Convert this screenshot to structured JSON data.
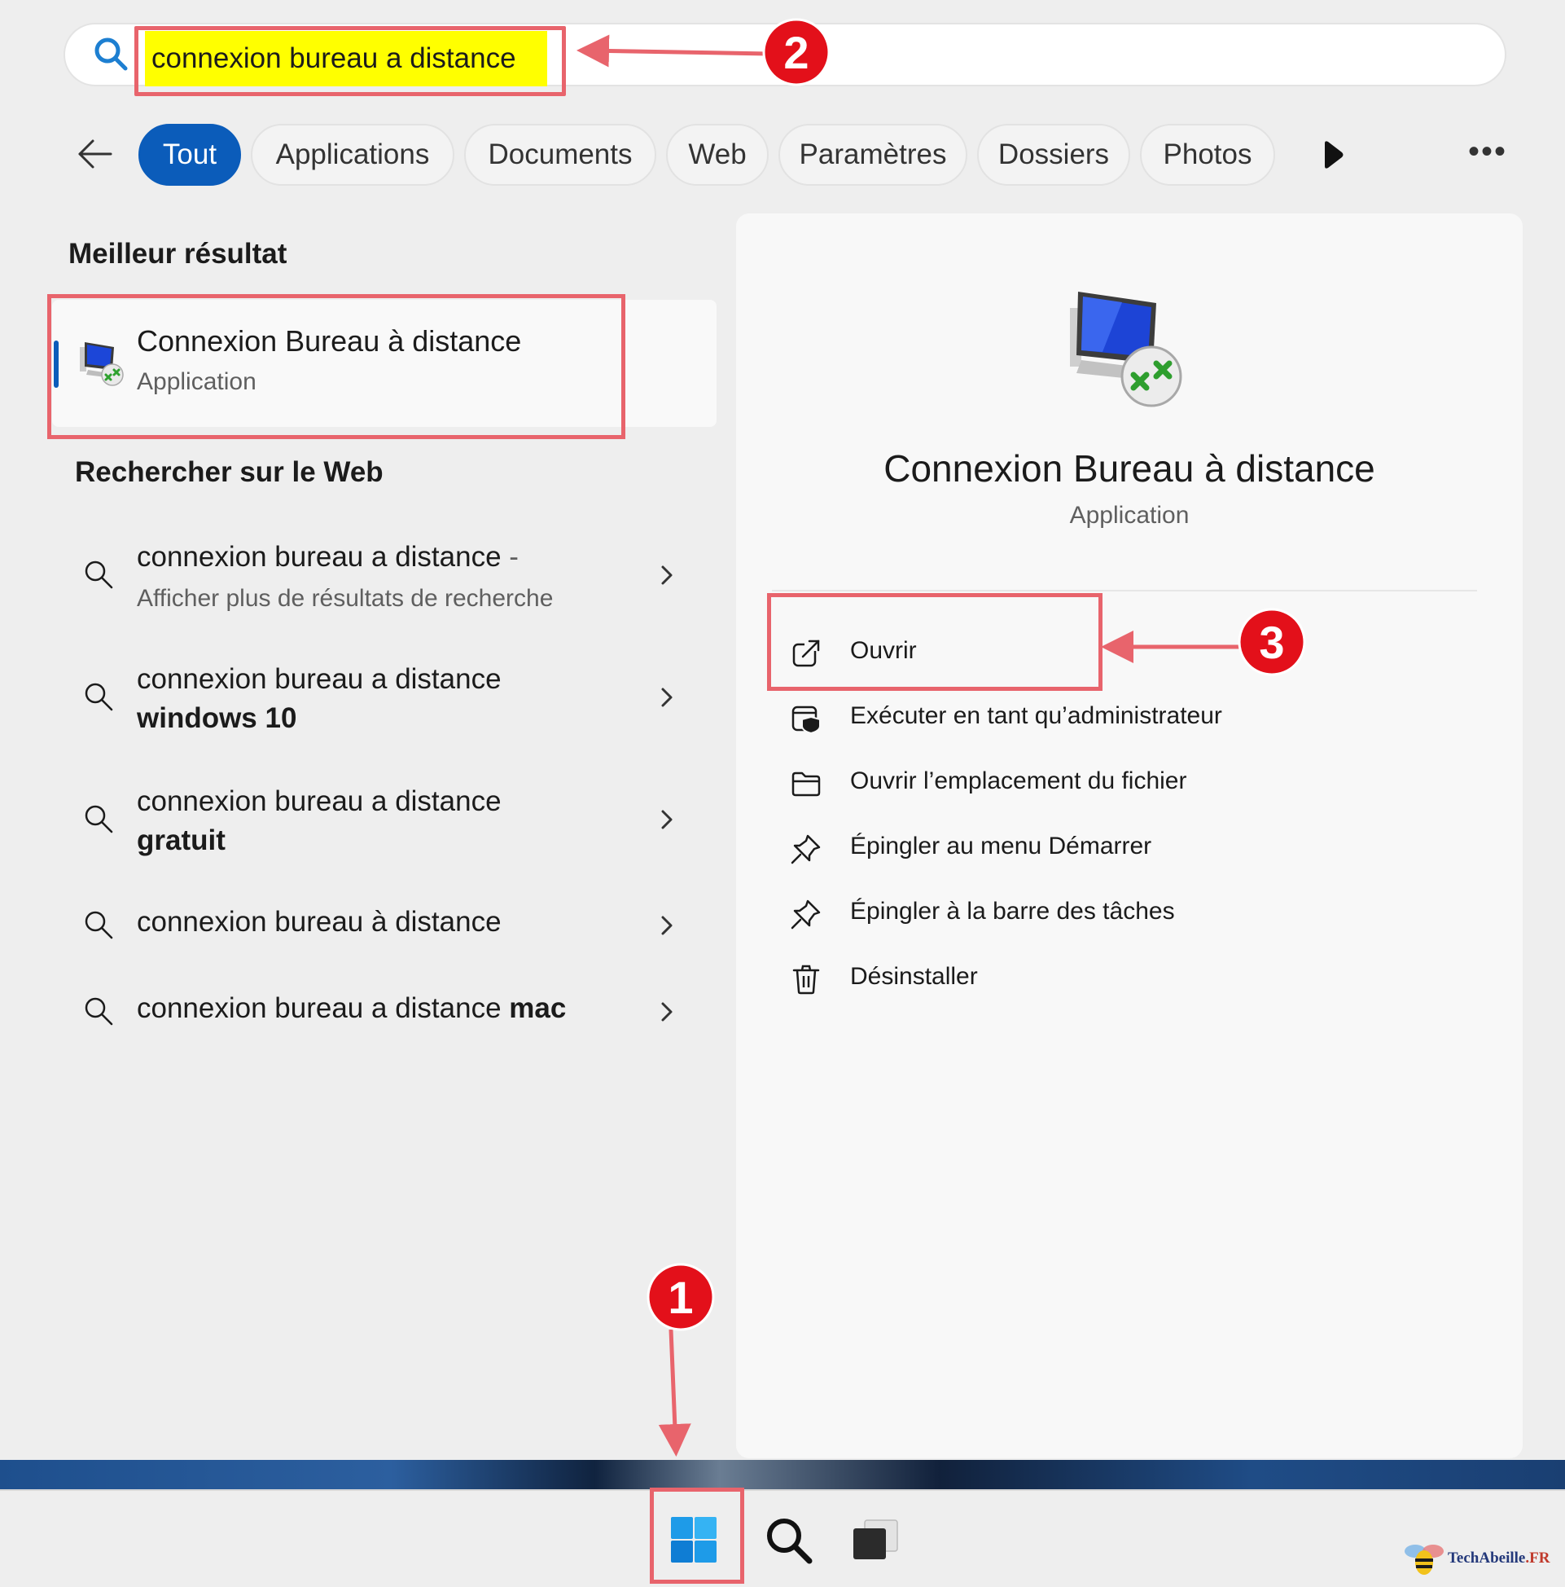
{
  "search": {
    "query": "connexion bureau a distance"
  },
  "filters": {
    "chips": [
      "Tout",
      "Applications",
      "Documents",
      "Web",
      "Paramètres",
      "Dossiers",
      "Photos"
    ],
    "active": "Tout"
  },
  "best_match": {
    "heading": "Meilleur résultat",
    "title": "Connexion Bureau à distance",
    "subtitle": "Application"
  },
  "web": {
    "heading": "Rechercher sur le Web",
    "items": [
      {
        "text": "connexion bureau a distance",
        "bold": "",
        "suffix": " -",
        "sub": "Afficher plus de résultats de recherche"
      },
      {
        "text": "connexion bureau a distance",
        "bold": "windows 10",
        "suffix": "",
        "sub": ""
      },
      {
        "text": "connexion bureau a distance",
        "bold": "gratuit",
        "suffix": "",
        "sub": ""
      },
      {
        "text": "connexion bureau à distance",
        "bold": "",
        "suffix": "",
        "sub": ""
      },
      {
        "text": "connexion bureau a distance",
        "bold": "mac",
        "suffix": "",
        "sub": ""
      }
    ]
  },
  "detail": {
    "title": "Connexion Bureau à distance",
    "subtitle": "Application",
    "actions": [
      {
        "label": "Ouvrir",
        "icon": "open-external-icon"
      },
      {
        "label": "Exécuter en tant qu’administrateur",
        "icon": "shield-admin-icon"
      },
      {
        "label": "Ouvrir l’emplacement du fichier",
        "icon": "folder-icon"
      },
      {
        "label": "Épingler au menu Démarrer",
        "icon": "pin-icon"
      },
      {
        "label": "Épingler à la barre des tâches",
        "icon": "pin-icon"
      },
      {
        "label": "Désinstaller",
        "icon": "trash-icon"
      }
    ]
  },
  "annotations": {
    "badges": [
      "1",
      "2",
      "3"
    ],
    "color": "#e8646c",
    "badge_color": "#e3101a"
  },
  "watermark": {
    "name": "TechAbeille",
    "tld": ".FR"
  },
  "colors": {
    "accent": "#0b5cba",
    "highlight": "#ffff00"
  }
}
